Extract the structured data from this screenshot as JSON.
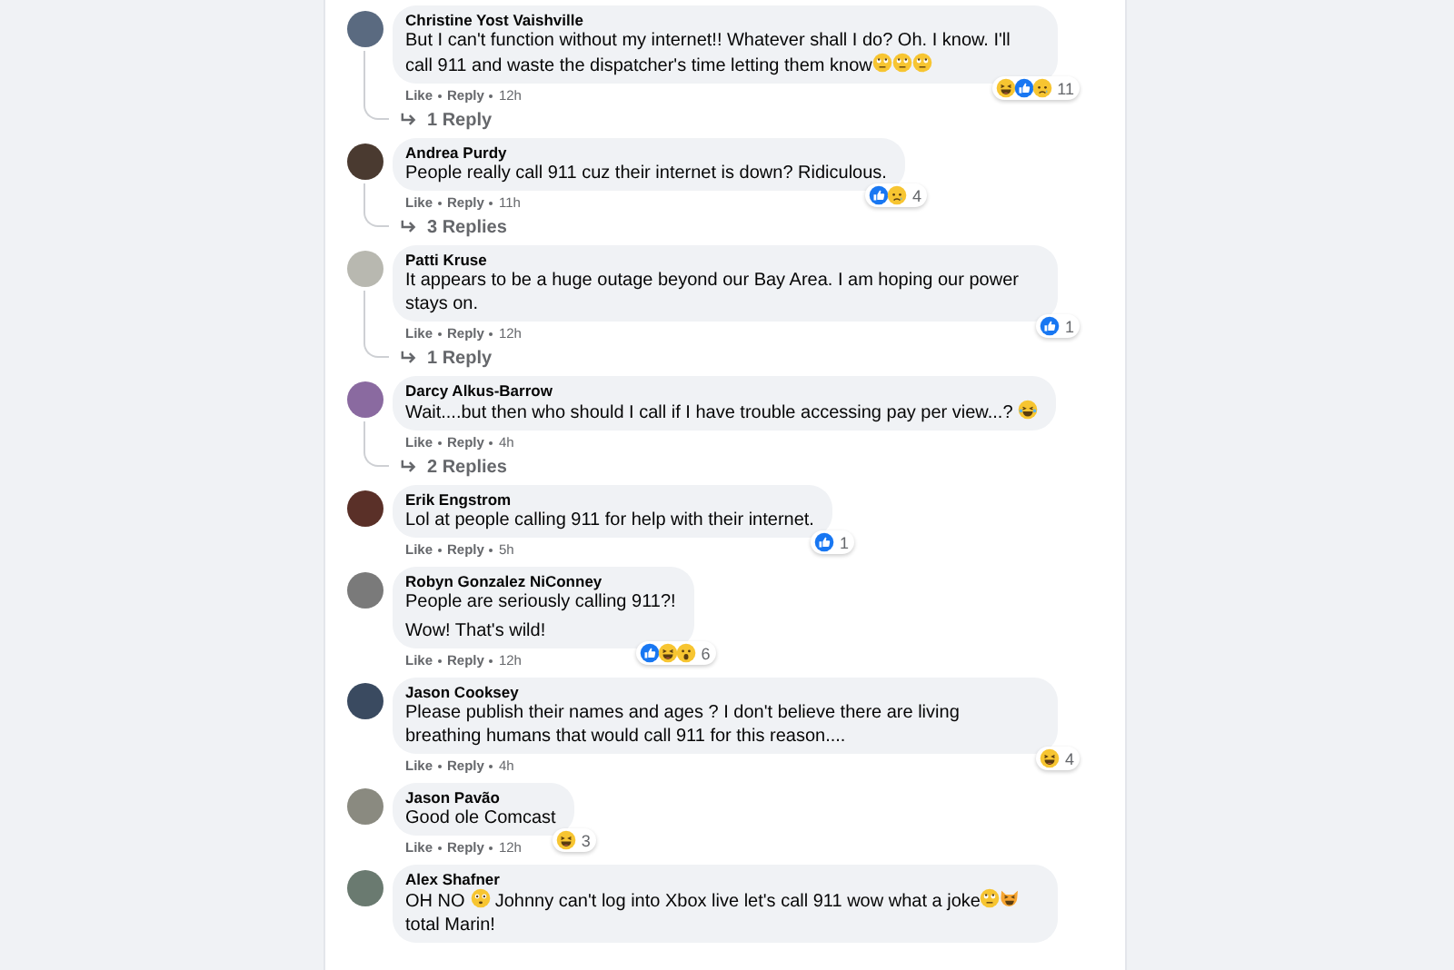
{
  "comments": [
    {
      "author": "Christine Yost Vaishville",
      "paragraphs": [
        [
          {
            "kind": "text",
            "text": "But I can't function without my internet!! Whatever shall I do? Oh. I know. I'll call 911 and waste the dispatcher's time letting them know"
          },
          {
            "kind": "rolleyes"
          },
          {
            "kind": "rolleyes"
          },
          {
            "kind": "rolleyes"
          }
        ]
      ],
      "like": "Like",
      "reply": "Reply",
      "time": "12h",
      "reactions": [
        {
          "kind": "haha"
        },
        {
          "kind": "like"
        },
        {
          "kind": "sad"
        }
      ],
      "reaction_count": "11",
      "replies": "1 Reply"
    },
    {
      "author": "Andrea Purdy",
      "paragraphs": [
        [
          {
            "kind": "text",
            "text": "People really call 911 cuz their internet is down? Ridiculous."
          }
        ]
      ],
      "like": "Like",
      "reply": "Reply",
      "time": "11h",
      "reactions": [
        {
          "kind": "like"
        },
        {
          "kind": "sad"
        }
      ],
      "reaction_count": "4",
      "replies": "3 Replies"
    },
    {
      "author": "Patti Kruse",
      "paragraphs": [
        [
          {
            "kind": "text",
            "text": "It appears to be a huge outage beyond our Bay Area. I am hoping our power stays on."
          }
        ]
      ],
      "like": "Like",
      "reply": "Reply",
      "time": "12h",
      "reactions": [
        {
          "kind": "like"
        }
      ],
      "reaction_count": "1",
      "replies": "1 Reply"
    },
    {
      "author": "Darcy Alkus-Barrow",
      "paragraphs": [
        [
          {
            "kind": "text",
            "text": "Wait....but then who should I call if I have trouble accessing pay per view...? "
          },
          {
            "kind": "laugh"
          }
        ]
      ],
      "like": "Like",
      "reply": "Reply",
      "time": "4h",
      "replies": "2 Replies"
    },
    {
      "author": "Erik Engstrom",
      "paragraphs": [
        [
          {
            "kind": "text",
            "text": "Lol at people calling 911 for help with their internet."
          }
        ]
      ],
      "like": "Like",
      "reply": "Reply",
      "time": "5h",
      "reactions": [
        {
          "kind": "like"
        }
      ],
      "reaction_count": "1"
    },
    {
      "author": "Robyn Gonzalez NiConney",
      "paragraphs": [
        [
          {
            "kind": "text",
            "text": "People are seriously calling 911?!"
          }
        ],
        [
          {
            "kind": "text",
            "text": "Wow! That's wild!"
          }
        ]
      ],
      "like": "Like",
      "reply": "Reply",
      "time": "12h",
      "reactions": [
        {
          "kind": "like"
        },
        {
          "kind": "haha"
        },
        {
          "kind": "wow"
        }
      ],
      "reaction_count": "6"
    },
    {
      "author": "Jason Cooksey",
      "paragraphs": [
        [
          {
            "kind": "text",
            "text": "Please publish their names and ages ? I don't believe there are living breathing humans that would call 911 for this reason...."
          }
        ]
      ],
      "like": "Like",
      "reply": "Reply",
      "time": "4h",
      "reactions": [
        {
          "kind": "haha"
        }
      ],
      "reaction_count": "4"
    },
    {
      "author": "Jason Pavão",
      "paragraphs": [
        [
          {
            "kind": "text",
            "text": "Good ole Comcast"
          }
        ]
      ],
      "like": "Like",
      "reply": "Reply",
      "time": "12h",
      "reactions": [
        {
          "kind": "haha"
        }
      ],
      "reaction_count": "3"
    },
    {
      "author": "Alex Shafner",
      "paragraphs": [
        [
          {
            "kind": "text",
            "text": "OH NO "
          },
          {
            "kind": "flushed"
          },
          {
            "kind": "text",
            "text": " Johnny can't log into Xbox live let's call 911 wow what a joke"
          },
          {
            "kind": "rolleyes"
          },
          {
            "kind": "catjoy"
          },
          {
            "kind": "text",
            "text": " total Marin!"
          }
        ]
      ]
    }
  ]
}
